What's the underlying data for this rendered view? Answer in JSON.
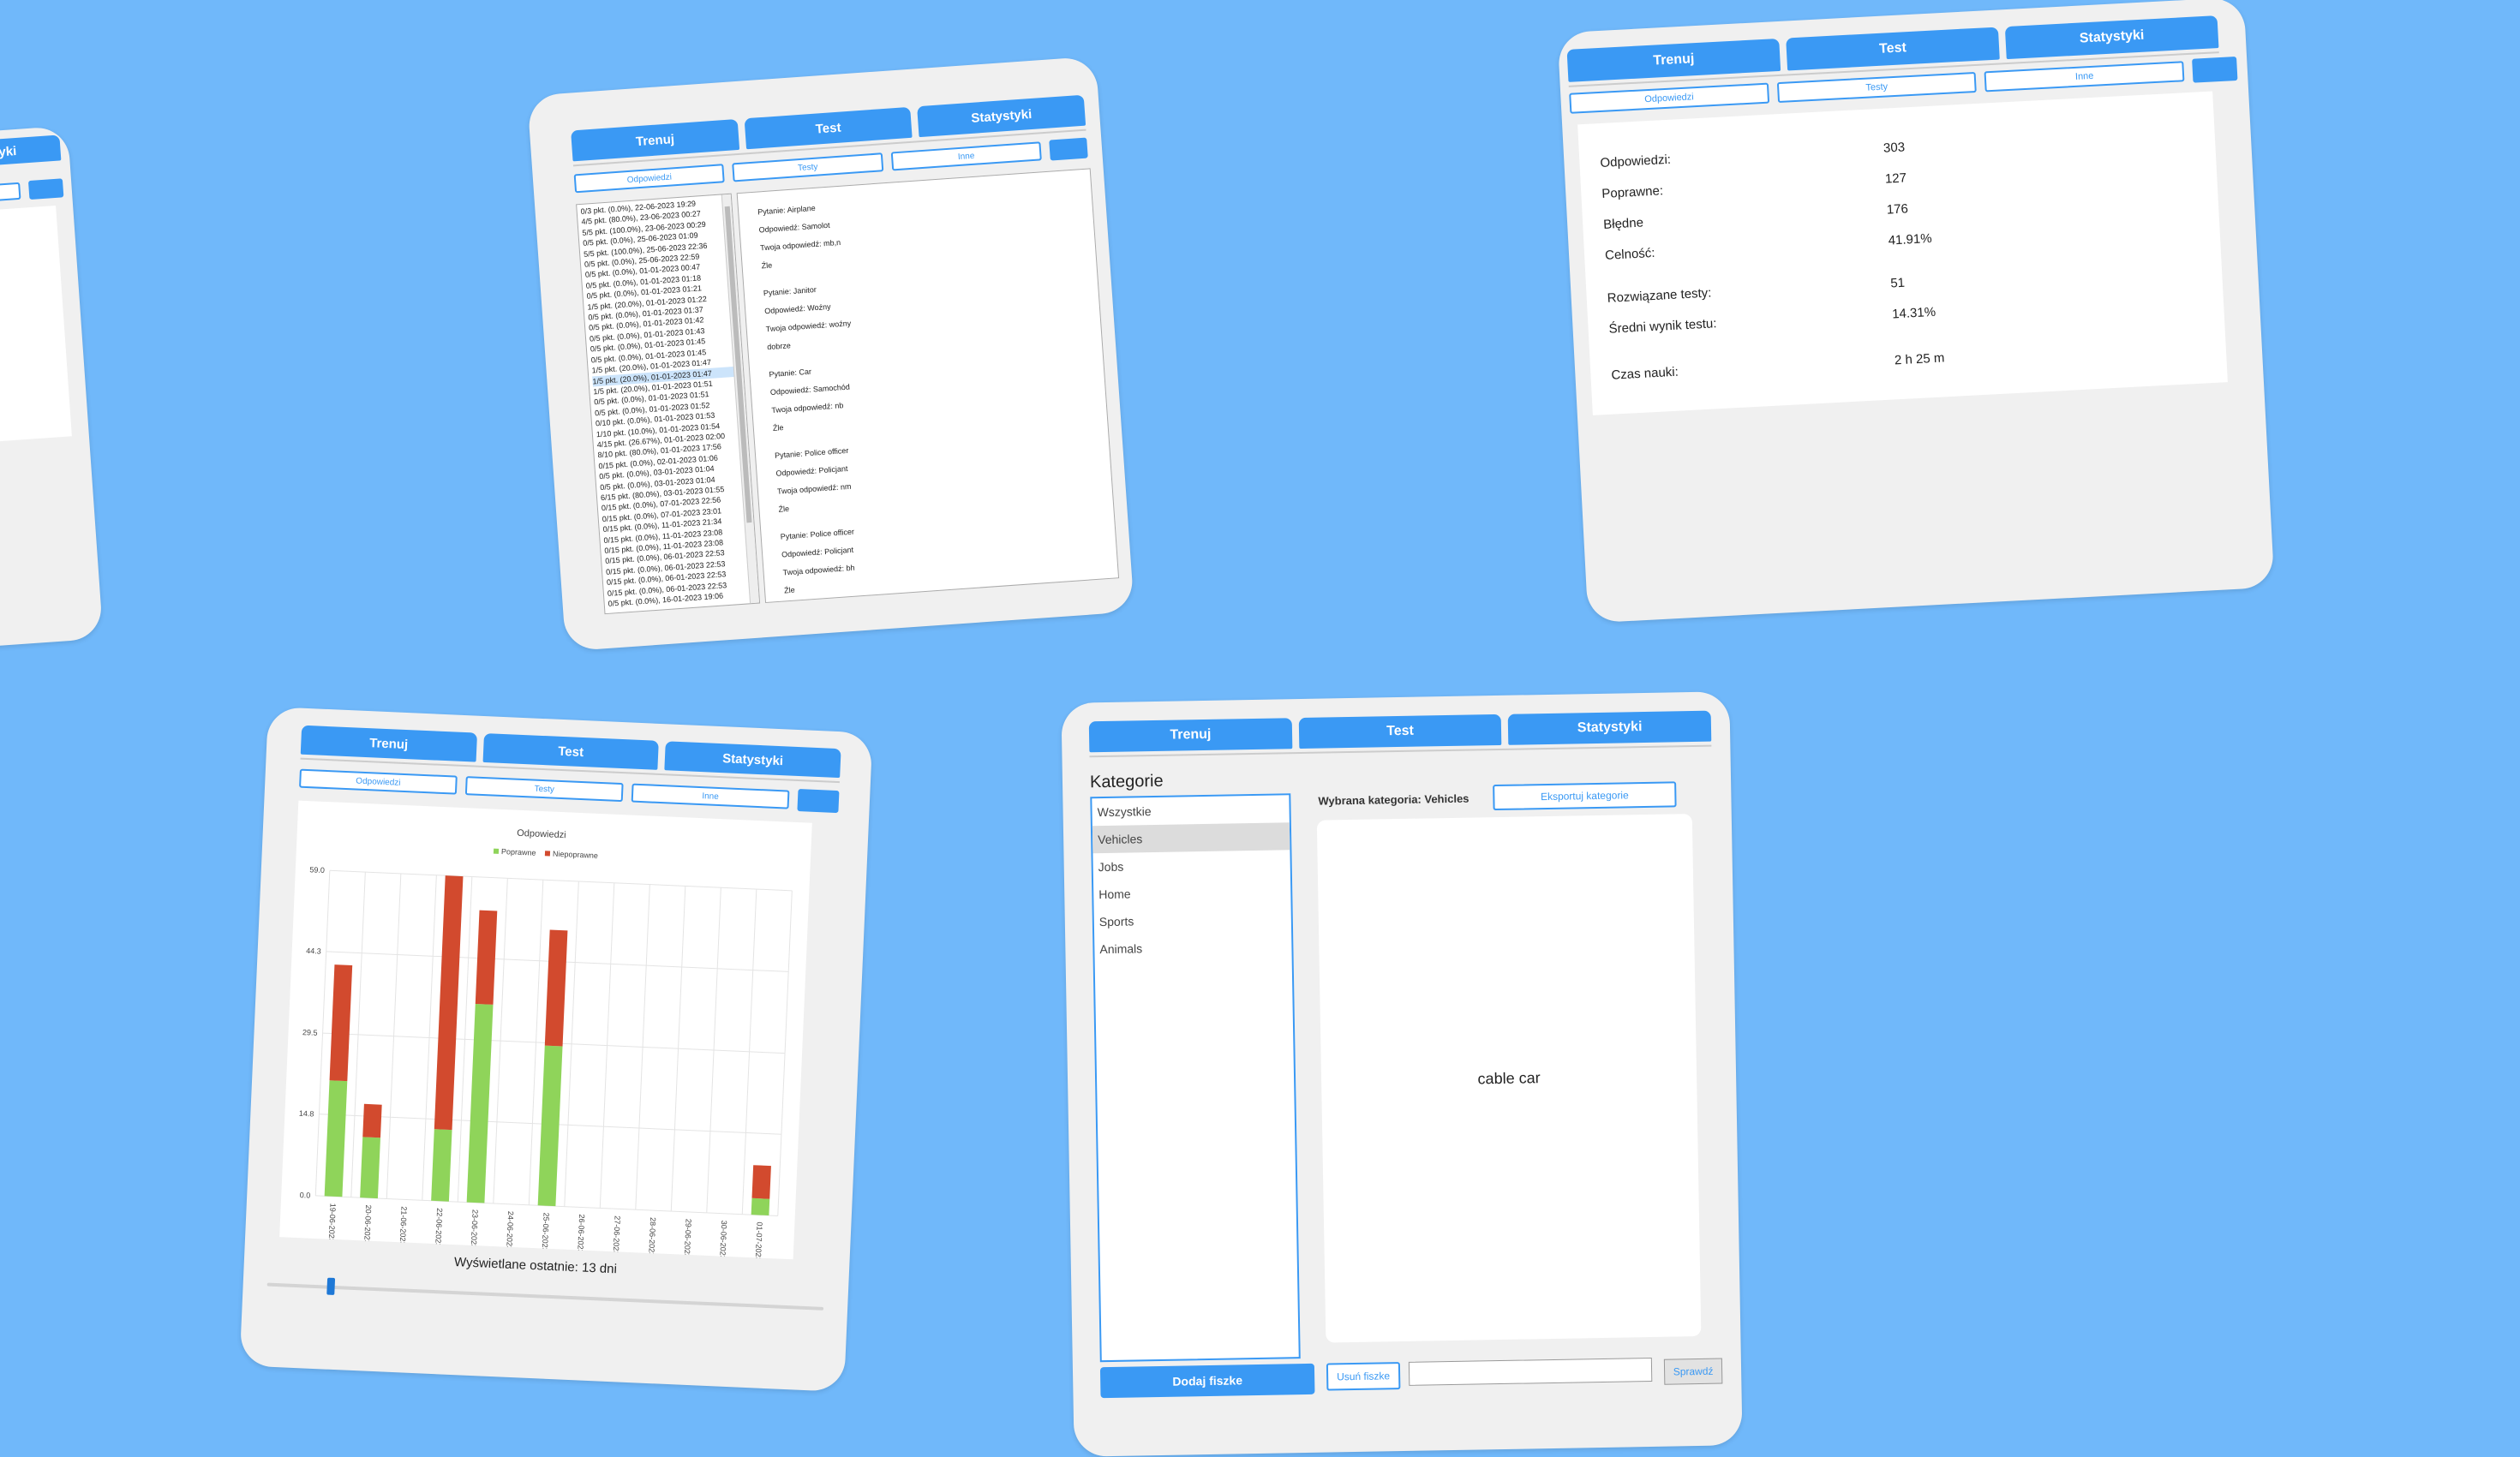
{
  "nav": {
    "train": "Trenuj",
    "test": "Test",
    "stats": "Statystyki"
  },
  "subnav": {
    "answers": "Odpowiedzi",
    "tests": "Testy",
    "other": "Inne"
  },
  "partial_window": {
    "tab": "tystyki"
  },
  "history_window": {
    "answers_link": "Odpowiedzi",
    "list": [
      "0/3 pkt. (0.0%), 22-06-2023 19:29",
      "4/5 pkt. (80.0%), 23-06-2023 00:27",
      "5/5 pkt. (100.0%), 23-06-2023 00:29",
      "0/5 pkt. (0.0%), 25-06-2023 01:09",
      "5/5 pkt. (100.0%), 25-06-2023 22:36",
      "0/5 pkt. (0.0%), 25-06-2023 22:59",
      "0/5 pkt. (0.0%), 01-01-2023 00:47",
      "0/5 pkt. (0.0%), 01-01-2023 01:18",
      "0/5 pkt. (0.0%), 01-01-2023 01:21",
      "1/5 pkt. (20.0%), 01-01-2023 01:22",
      "0/5 pkt. (0.0%), 01-01-2023 01:37",
      "0/5 pkt. (0.0%), 01-01-2023 01:42",
      "0/5 pkt. (0.0%), 01-01-2023 01:43",
      "0/5 pkt. (0.0%), 01-01-2023 01:45",
      "0/5 pkt. (0.0%), 01-01-2023 01:45",
      "1/5 pkt. (20.0%), 01-01-2023 01:47",
      "1/5 pkt. (20.0%), 01-01-2023 01:47",
      "1/5 pkt. (20.0%), 01-01-2023 01:51",
      "0/5 pkt. (0.0%), 01-01-2023 01:51",
      "0/5 pkt. (0.0%), 01-01-2023 01:52",
      "0/10 pkt. (0.0%), 01-01-2023 01:53",
      "1/10 pkt. (10.0%), 01-01-2023 01:54",
      "4/15 pkt. (26.67%), 01-01-2023 02:00",
      "8/10 pkt. (80.0%), 01-01-2023 17:56",
      "0/15 pkt. (0.0%), 02-01-2023 01:06",
      "0/5 pkt. (0.0%), 03-01-2023 01:04",
      "0/5 pkt. (0.0%), 03-01-2023 01:04",
      "6/15 pkt. (80.0%), 03-01-2023 01:55",
      "0/15 pkt. (0.0%), 07-01-2023 22:56",
      "0/15 pkt. (0.0%), 07-01-2023 23:01",
      "0/15 pkt. (0.0%), 11-01-2023 21:34",
      "0/15 pkt. (0.0%), 11-01-2023 23:08",
      "0/15 pkt. (0.0%), 11-01-2023 23:08",
      "0/15 pkt. (0.0%), 06-01-2023 22:53",
      "0/15 pkt. (0.0%), 06-01-2023 22:53",
      "0/15 pkt. (0.0%), 06-01-2023 22:53",
      "0/15 pkt. (0.0%), 06-01-2023 22:53",
      "0/5 pkt. (0.0%), 16-01-2023 19:06"
    ],
    "selected_index": 16,
    "details": [
      {
        "q": "Pytanie: Airplane",
        "a": "Odpowiedź: Samolot",
        "y": "Twoja odpowiedź: mb,n",
        "r": "Źle"
      },
      {
        "q": "Pytanie: Janitor",
        "a": "Odpowiedź: Woźny",
        "y": "Twoja odpowiedź: woźny",
        "r": "dobrze"
      },
      {
        "q": "Pytanie: Car",
        "a": "Odpowiedź: Samochód",
        "y": "Twoja odpowiedź: nb",
        "r": "Źle"
      },
      {
        "q": "Pytanie: Police officer",
        "a": "Odpowiedź: Policjant",
        "y": "Twoja odpowiedź: nm",
        "r": "Źle"
      },
      {
        "q": "Pytanie: Police officer",
        "a": "Odpowiedź: Policjant",
        "y": "Twoja odpowiedź: bh",
        "r": "Źle"
      }
    ]
  },
  "stats_window": {
    "labels": {
      "answers": "Odpowiedzi:",
      "correct": "Poprawne:",
      "wrong": "Błędne",
      "accuracy": "Celność:",
      "solved": "Rozwiązane testy:",
      "avg": "Średni wynik testu:",
      "time": "Czas nauki:"
    },
    "values": {
      "answers": "303",
      "correct": "127",
      "wrong": "176",
      "accuracy": "41.91%",
      "solved": "51",
      "avg": "14.31%",
      "time": "2 h 25 m"
    }
  },
  "chart_window": {
    "footer": "Wyświetlane ostatnie: 13 dni",
    "slider_value": 13
  },
  "chart_data": {
    "type": "bar",
    "title": "Odpowiedzi",
    "stacked": true,
    "categories": [
      "19-06-2023",
      "20-06-2023",
      "21-06-2023",
      "22-06-2023",
      "23-06-2023",
      "24-06-2023",
      "25-06-2023",
      "26-06-2023",
      "27-06-2023",
      "28-06-2023",
      "29-06-2023",
      "30-06-2023",
      "01-07-2023"
    ],
    "series": [
      {
        "name": "Poprawne",
        "color": "#8fd45a",
        "values": [
          21,
          11,
          0,
          13,
          36,
          0,
          29,
          0,
          0,
          0,
          0,
          0,
          3
        ]
      },
      {
        "name": "Niepoprawne",
        "color": "#d24a2e",
        "values": [
          21,
          6,
          0,
          46,
          17,
          0,
          21,
          0,
          0,
          0,
          0,
          0,
          6
        ]
      }
    ],
    "yticks": [
      "0.0",
      "14.8",
      "29.5",
      "44.3",
      "59.0"
    ],
    "ylim": [
      0,
      59.0
    ],
    "legend": "top",
    "grid": true
  },
  "category_window": {
    "header": "Kategorie",
    "categories": [
      "Wszystkie",
      "Vehicles",
      "Jobs",
      "Home",
      "Sports",
      "Animals"
    ],
    "selected_index": 1,
    "selected_label": "Wybrana kategoria: Vehicles",
    "export_btn": "Eksportuj kategorie",
    "card_text": "cable car",
    "add_btn": "Dodaj fiszke",
    "remove_btn": "Usuń fiszke",
    "input_value": "",
    "check_btn": "Sprawdź"
  }
}
